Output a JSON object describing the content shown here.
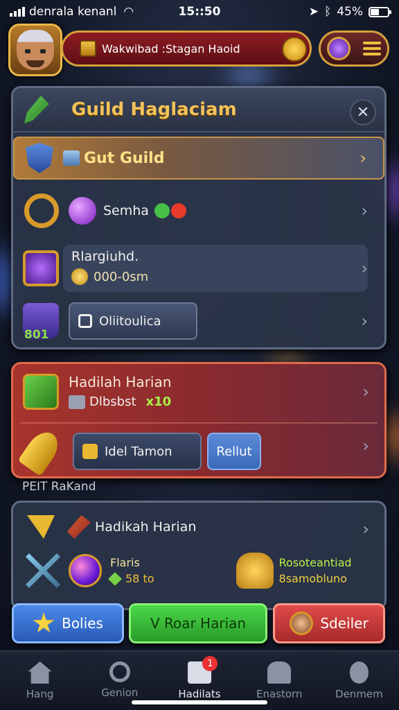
{
  "status_bar": {
    "carrier": "denrala kenanl",
    "time": "15::50",
    "battery": "45%"
  },
  "header": {
    "title": "Wakwibad :Stagan Haoid"
  },
  "panel": {
    "title": "Guild Haglaciam",
    "gold_row_label": "Gut Guild",
    "row2_label": "Semha",
    "row3_title": "Rlargiuhd.",
    "row3_value": "000-0sm",
    "row4_button": "Oliitoulica"
  },
  "red_panel": {
    "title": "Hadilah Harian",
    "sub_label": "Dlbsbst",
    "sub_amount": "x10",
    "btn1": "Idel Tamon",
    "btn2": "Rellut"
  },
  "section_label": "PEIT RaKand",
  "low_panel": {
    "title": "Hadikah Harian",
    "stat1_a": "Flaris",
    "stat1_b": "58 to",
    "stat2_a": "Rosoteantiad",
    "stat2_b": "8samobluno"
  },
  "actions": {
    "blue": "Bolies",
    "green": "V Roar Harian",
    "red": "Sdeiler"
  },
  "nav": {
    "items": [
      "Hang",
      "Genion",
      "Hadilats",
      "Enastorn",
      "Denmem"
    ],
    "badge": "1",
    "active_index": 2
  }
}
